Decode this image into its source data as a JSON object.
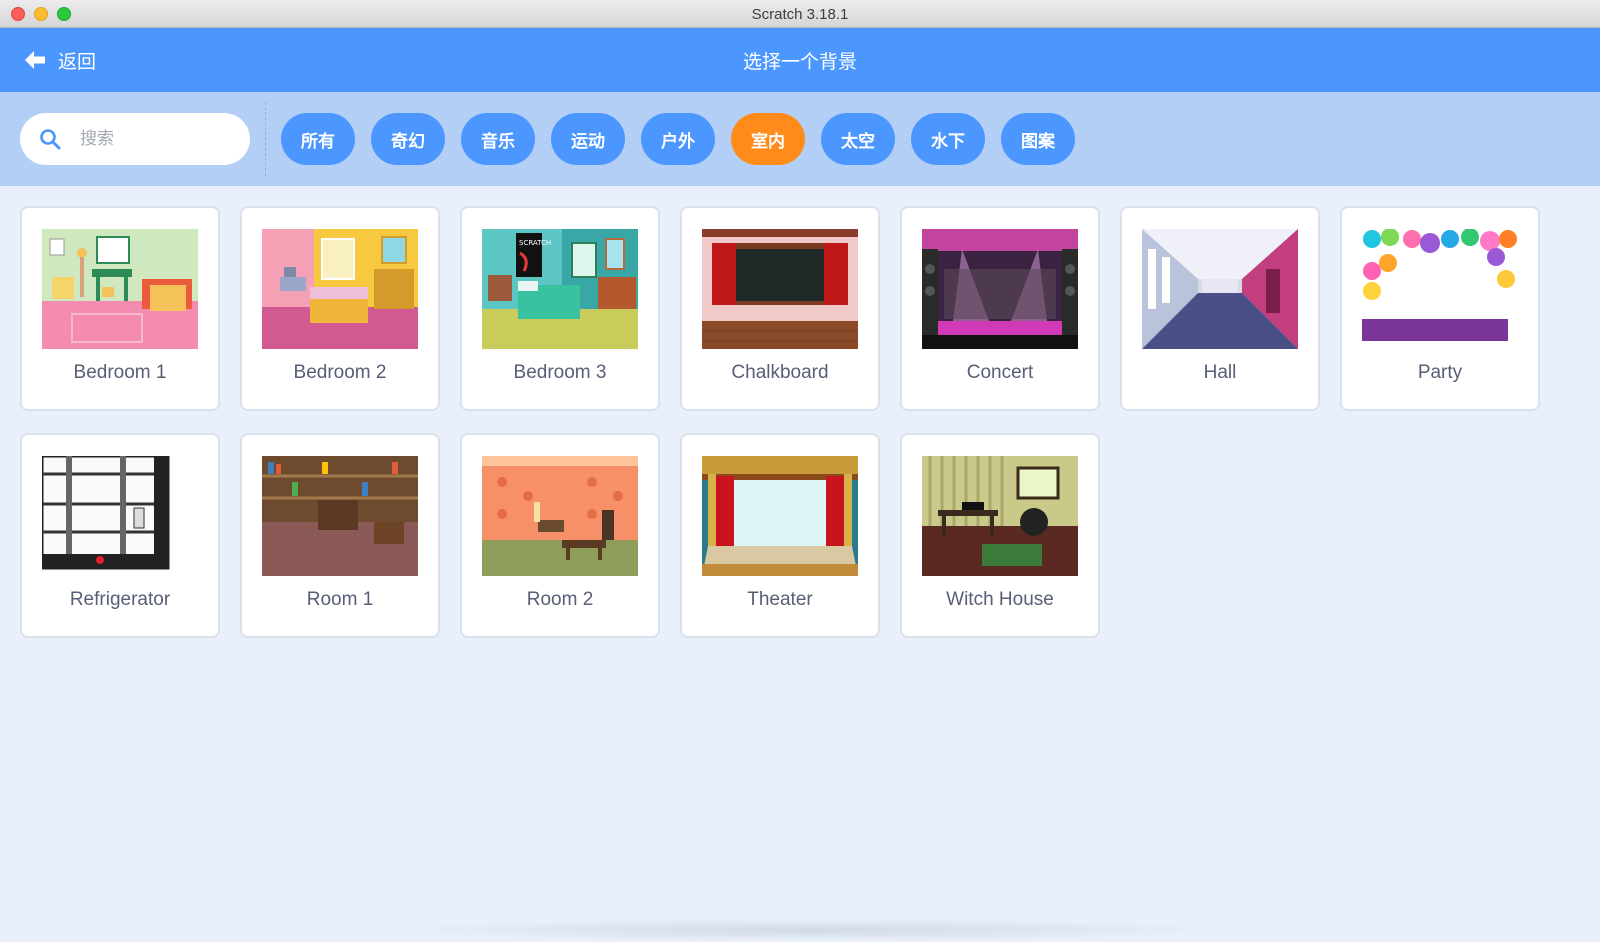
{
  "window": {
    "title": "Scratch 3.18.1"
  },
  "header": {
    "back_label": "返回",
    "title": "选择一个背景"
  },
  "search": {
    "placeholder": "搜索",
    "value": ""
  },
  "tags": [
    {
      "label": "所有",
      "active": false
    },
    {
      "label": "奇幻",
      "active": false
    },
    {
      "label": "音乐",
      "active": false
    },
    {
      "label": "运动",
      "active": false
    },
    {
      "label": "户外",
      "active": false
    },
    {
      "label": "室内",
      "active": true
    },
    {
      "label": "太空",
      "active": false
    },
    {
      "label": "水下",
      "active": false
    },
    {
      "label": "图案",
      "active": false
    }
  ],
  "backdrops": [
    {
      "name": "Bedroom 1"
    },
    {
      "name": "Bedroom 2"
    },
    {
      "name": "Bedroom 3"
    },
    {
      "name": "Chalkboard"
    },
    {
      "name": "Concert"
    },
    {
      "name": "Hall"
    },
    {
      "name": "Party"
    },
    {
      "name": "Refrigerator"
    },
    {
      "name": "Room 1"
    },
    {
      "name": "Room 2"
    },
    {
      "name": "Theater"
    },
    {
      "name": "Witch House"
    }
  ],
  "colors": {
    "header": "#4c97ff",
    "filterbar": "#b3cff5",
    "active_tag": "#ff8c1a",
    "tag": "#4c97ff",
    "background": "#e9f0fb"
  }
}
